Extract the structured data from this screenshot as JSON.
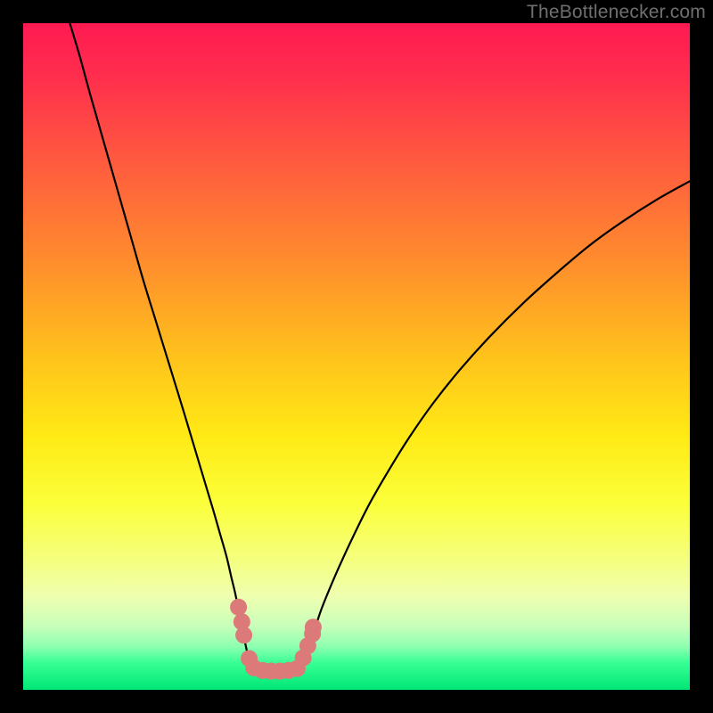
{
  "watermark": "TheBottlenecker.com",
  "chart_data": {
    "type": "line",
    "title": "",
    "xlabel": "",
    "ylabel": "",
    "xlim": [
      0,
      100
    ],
    "ylim": [
      0,
      100
    ],
    "background_gradient": {
      "stops": [
        {
          "offset": 0.0,
          "color": "#ff1a52"
        },
        {
          "offset": 0.08,
          "color": "#ff2e4d"
        },
        {
          "offset": 0.2,
          "color": "#ff5840"
        },
        {
          "offset": 0.35,
          "color": "#ff8a2e"
        },
        {
          "offset": 0.5,
          "color": "#ffc21c"
        },
        {
          "offset": 0.62,
          "color": "#ffea15"
        },
        {
          "offset": 0.72,
          "color": "#fbff3a"
        },
        {
          "offset": 0.8,
          "color": "#f5ff7a"
        },
        {
          "offset": 0.86,
          "color": "#efffb0"
        },
        {
          "offset": 0.905,
          "color": "#c7ffba"
        },
        {
          "offset": 0.935,
          "color": "#8dffb0"
        },
        {
          "offset": 0.96,
          "color": "#37ff94"
        },
        {
          "offset": 1.0,
          "color": "#00e676"
        }
      ]
    },
    "series": [
      {
        "name": "left-curve",
        "type": "line",
        "points_xy": [
          [
            7,
            100
          ],
          [
            8.5,
            95
          ],
          [
            10,
            89.5
          ],
          [
            12,
            82.5
          ],
          [
            14,
            75.5
          ],
          [
            16,
            68.5
          ],
          [
            18,
            61.5
          ],
          [
            20,
            55
          ],
          [
            22,
            48.5
          ],
          [
            24,
            42
          ],
          [
            25.5,
            37
          ],
          [
            27,
            32
          ],
          [
            28.5,
            27
          ],
          [
            29.5,
            23.5
          ],
          [
            30.5,
            20
          ],
          [
            31.2,
            17
          ],
          [
            31.8,
            14.5
          ],
          [
            32.3,
            12
          ],
          [
            32.8,
            9.5
          ],
          [
            33.3,
            7
          ],
          [
            33.9,
            4.5
          ],
          [
            34.5,
            3.3
          ]
        ]
      },
      {
        "name": "right-curve",
        "type": "line",
        "points_xy": [
          [
            41.5,
            3.3
          ],
          [
            42.2,
            4.8
          ],
          [
            42.9,
            6.7
          ],
          [
            43.7,
            9
          ],
          [
            44.7,
            12
          ],
          [
            45.9,
            15
          ],
          [
            47.5,
            18.7
          ],
          [
            49.5,
            23
          ],
          [
            52,
            28
          ],
          [
            55,
            33.2
          ],
          [
            58,
            38
          ],
          [
            61.5,
            43
          ],
          [
            65.5,
            48
          ],
          [
            70,
            53
          ],
          [
            75,
            58
          ],
          [
            80,
            62.5
          ],
          [
            85,
            66.7
          ],
          [
            90,
            70.3
          ],
          [
            95,
            73.5
          ],
          [
            100,
            76.3
          ]
        ]
      },
      {
        "name": "marker-chain",
        "type": "markers",
        "color": "#db7a79",
        "points_xy": [
          [
            32.3,
            12.4
          ],
          [
            32.8,
            10.2
          ],
          [
            33.1,
            8.2
          ],
          [
            33.9,
            4.7
          ],
          [
            34.6,
            3.3
          ],
          [
            35.9,
            2.9
          ],
          [
            37.2,
            2.8
          ],
          [
            38.5,
            2.8
          ],
          [
            39.8,
            2.9
          ],
          [
            41.1,
            3.2
          ],
          [
            42.0,
            4.8
          ],
          [
            42.7,
            6.6
          ],
          [
            43.4,
            8.4
          ],
          [
            43.5,
            9.4
          ]
        ]
      }
    ]
  }
}
